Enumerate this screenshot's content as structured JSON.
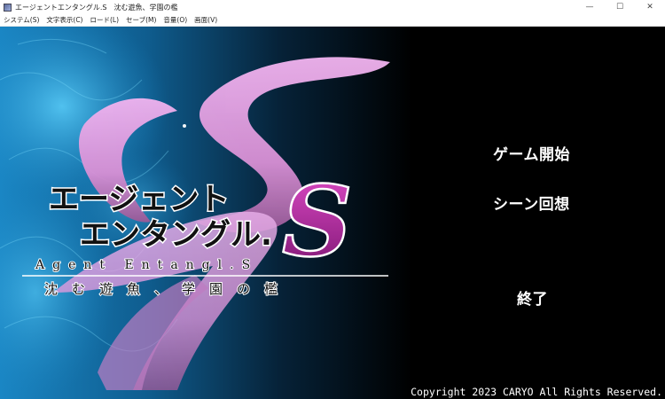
{
  "window": {
    "title": "エージェントエンタングル.S　沈む遊魚、学園の檻",
    "controls": {
      "minimize": "—",
      "maximize": "☐",
      "close": "✕"
    }
  },
  "menubar": {
    "items": [
      {
        "label": "システム(S)"
      },
      {
        "label": "文字表示(C)"
      },
      {
        "label": "ロード(L)"
      },
      {
        "label": "セーブ(M)"
      },
      {
        "label": "音量(O)"
      },
      {
        "label": "画面(V)"
      }
    ]
  },
  "logo": {
    "title_line1": "エージェント",
    "title_line2": "エンタングル.",
    "big_letter": "S",
    "english": "Agent Entangl.S",
    "subtitle": "沈む遊魚、学園の檻"
  },
  "title_menu": {
    "start": "ゲーム開始",
    "scene_recall": "シーン回想",
    "exit": "終了"
  },
  "footer": {
    "copyright": "Copyright  2023  CARYO  All Rights Reserved."
  },
  "colors": {
    "background": "#000000",
    "water_blue": "#1c7fb8",
    "logo_pink": "#e9a8e8",
    "logo_magenta": "#c22cab",
    "text": "#ffffff"
  }
}
